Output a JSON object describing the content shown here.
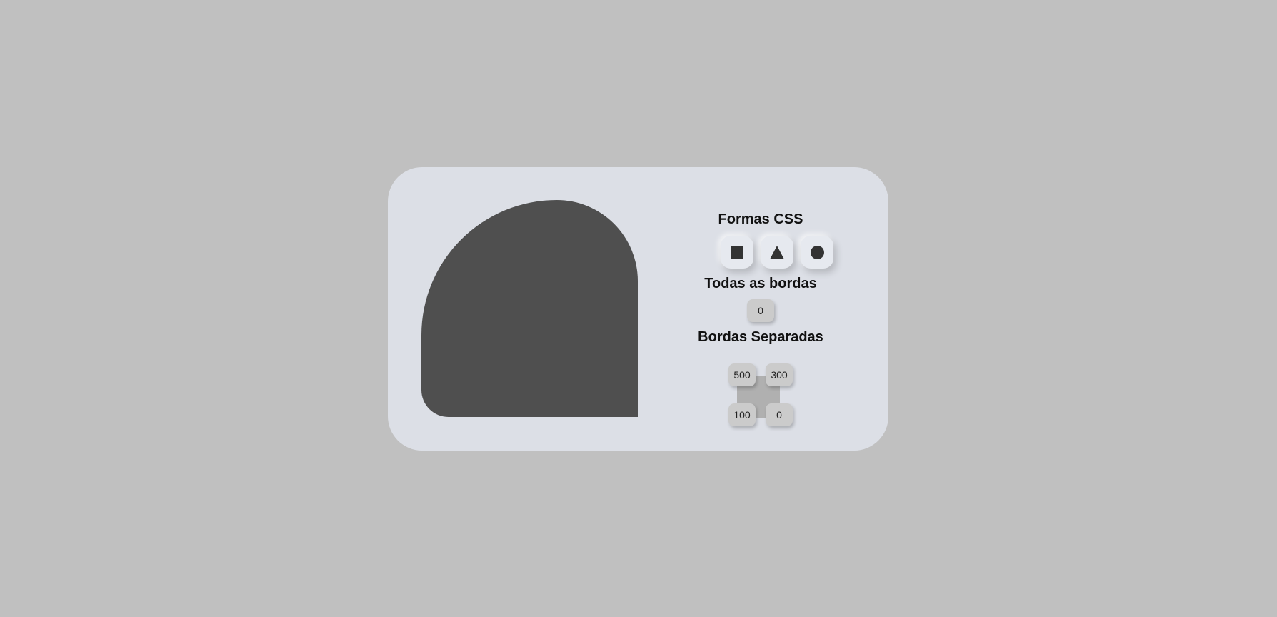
{
  "panel": {
    "title_shapes": "Formas CSS",
    "title_all_borders": "Todas as bordas",
    "title_separate_borders": "Bordas Separadas"
  },
  "shape_buttons": [
    {
      "icon": "square-icon"
    },
    {
      "icon": "triangle-icon"
    },
    {
      "icon": "circle-icon"
    }
  ],
  "all_borders": {
    "value": "0"
  },
  "separate_borders": {
    "top_left": "500",
    "top_right": "300",
    "bottom_left": "100",
    "bottom_right": "0"
  },
  "colors": {
    "background": "#c0c0c0",
    "card": "#dcdfe6",
    "shape": "#4f4f4f"
  }
}
